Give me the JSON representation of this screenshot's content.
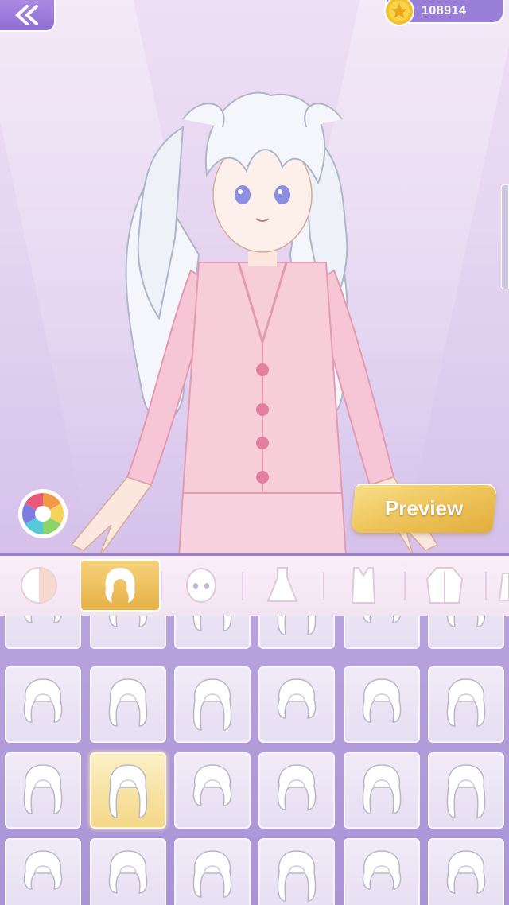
{
  "topbar": {
    "back_icon": "back-chevron-icon",
    "coin_icon": "star-coin-icon",
    "coins": "108914"
  },
  "stage": {
    "character": "pajama-girl",
    "color_wheel_icon": "color-wheel-icon",
    "preview_label": "Preview"
  },
  "tabs": [
    {
      "icon": "skin-tone-icon",
      "active": false
    },
    {
      "icon": "hair-icon",
      "active": true
    },
    {
      "icon": "face-icon",
      "active": false
    },
    {
      "icon": "dress-icon",
      "active": false
    },
    {
      "icon": "top-icon",
      "active": false
    },
    {
      "icon": "jacket-icon",
      "active": false
    },
    {
      "icon": "more-icon",
      "active": false
    }
  ],
  "hair_grid": {
    "rows": 4,
    "cols": 6,
    "selected_row": 2,
    "selected_col": 1
  },
  "colors": {
    "accent_purple": "#9b7fd0",
    "gold": "#e6b148",
    "pajama_pink": "#f6c6d6"
  }
}
